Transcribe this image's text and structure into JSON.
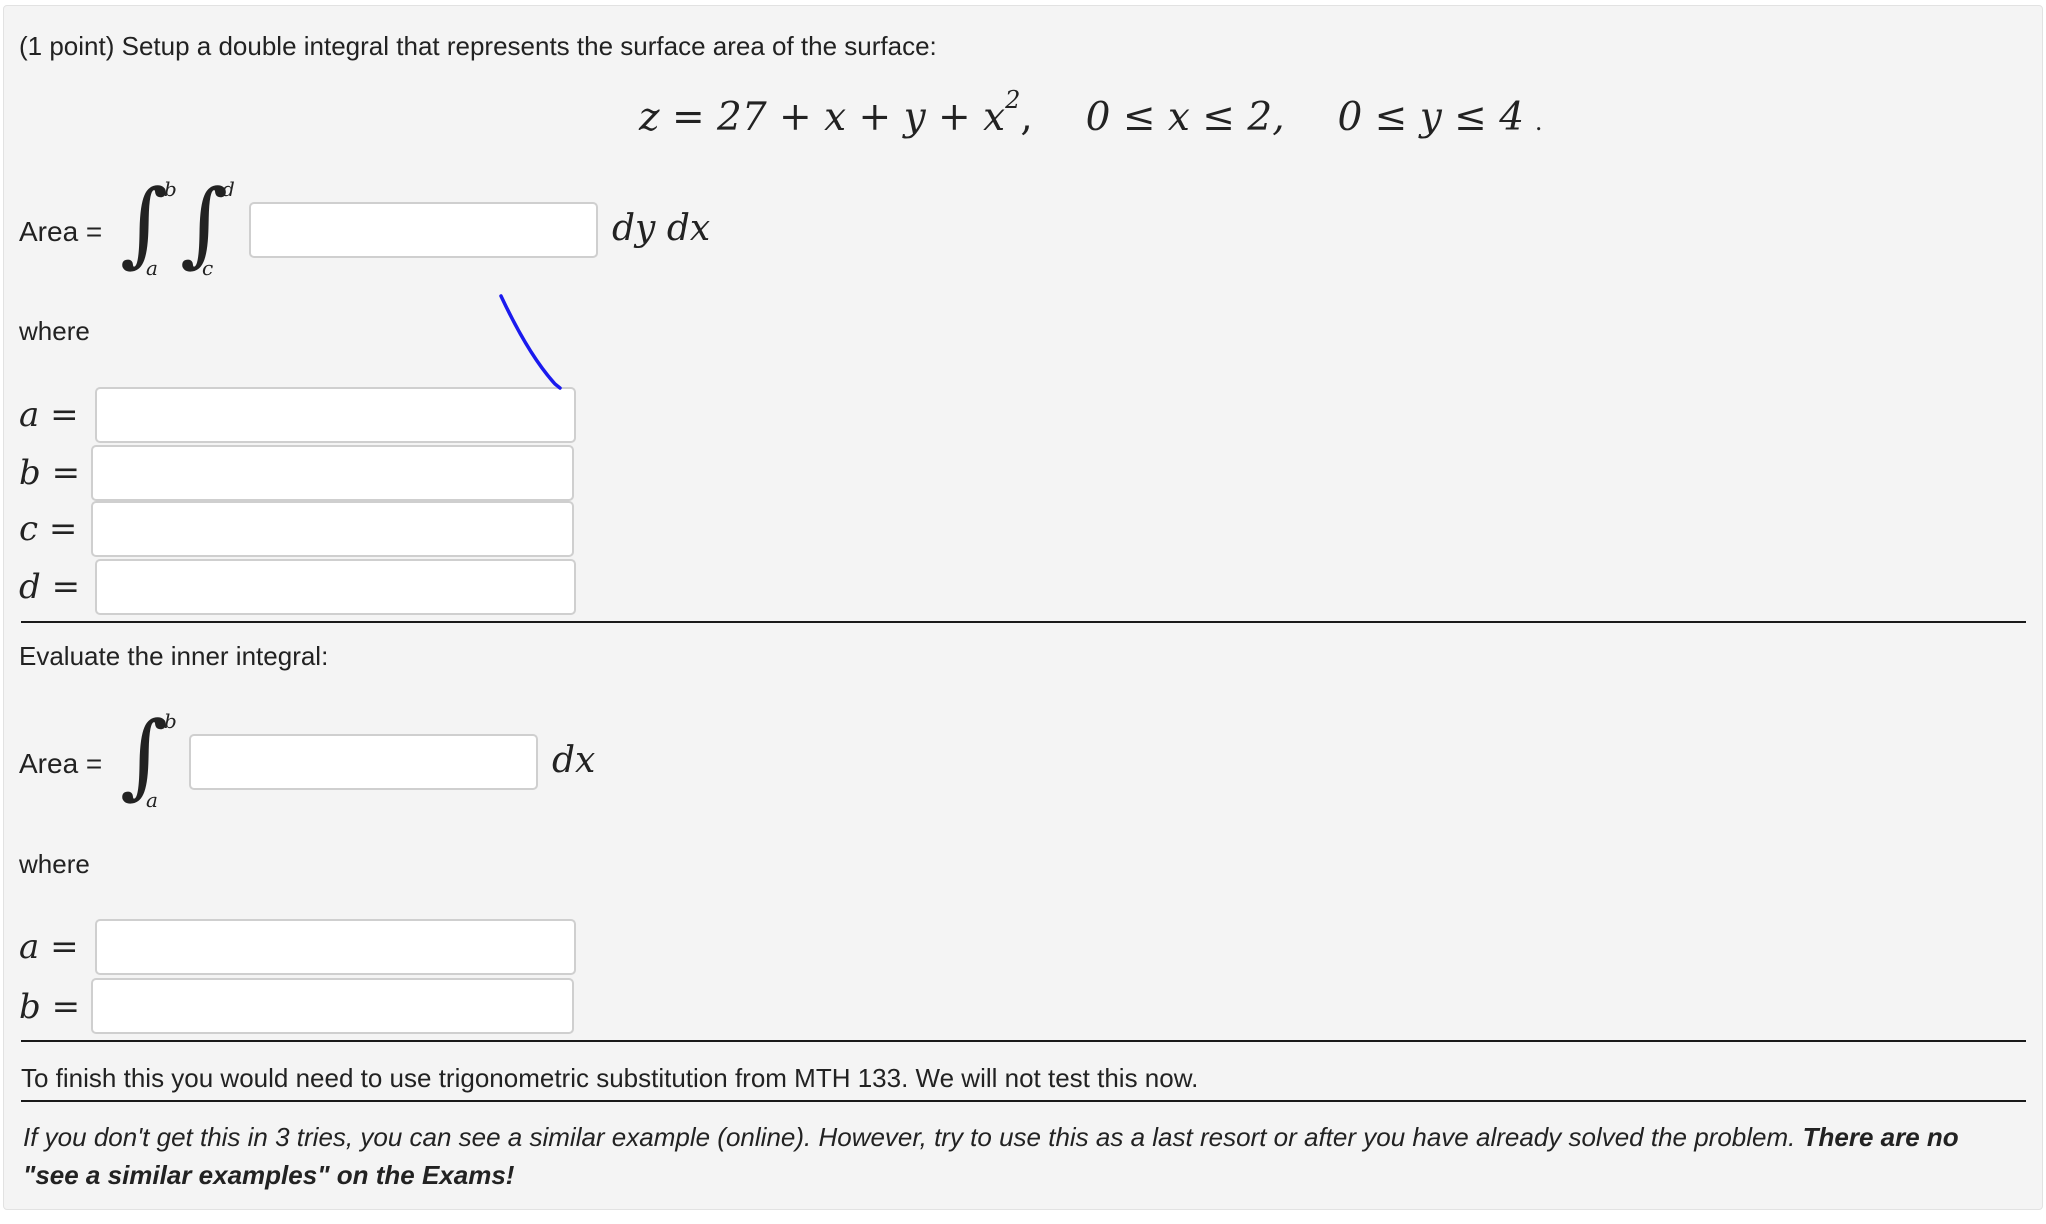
{
  "problem": {
    "header": "(1 point) Setup a double integral that represents the surface area of the surface:",
    "equation": "z = 27 + x + y + x², 0 ≤ x ≤ 2, 0 ≤ y ≤ 4 .",
    "equation_parts": {
      "z_eq": "z = 27 + x + y + x",
      "exp": "2",
      "comma": ",",
      "x_range": "0 ≤ x ≤ 2,",
      "y_range": "0 ≤ y ≤ 4",
      "period": "."
    }
  },
  "part1": {
    "area_label": "Area =",
    "integral": "∫",
    "outer_upper": "b",
    "outer_lower": "a",
    "inner_upper": "d",
    "inner_lower": "c",
    "differentials": "dy dx",
    "integrand_value": "",
    "where": "where",
    "fields": [
      {
        "label": "a =",
        "value": ""
      },
      {
        "label": "b =",
        "value": ""
      },
      {
        "label": "c =",
        "value": ""
      },
      {
        "label": "d =",
        "value": ""
      }
    ]
  },
  "part2": {
    "heading": "Evaluate the inner integral:",
    "area_label": "Area =",
    "integral": "∫",
    "upper": "b",
    "lower": "a",
    "differential": "dx",
    "integrand_value": "",
    "where": "where",
    "fields": [
      {
        "label": "a =",
        "value": ""
      },
      {
        "label": "b =",
        "value": ""
      }
    ]
  },
  "footer": {
    "note": "To finish this you would need to use trigonometric substitution from MTH 133. We will not test this now.",
    "hint_normal": "If you don't get this in 3 tries, you can see a similar example (online). However, try to use this as a last resort or after you have already solved the problem. ",
    "hint_bold": "There are no \"see a similar examples\" on the Exams!"
  },
  "colors": {
    "panel_bg": "#f4f4f4",
    "ink_stroke": "#1a1aee",
    "rule": "#1a1a1a"
  }
}
